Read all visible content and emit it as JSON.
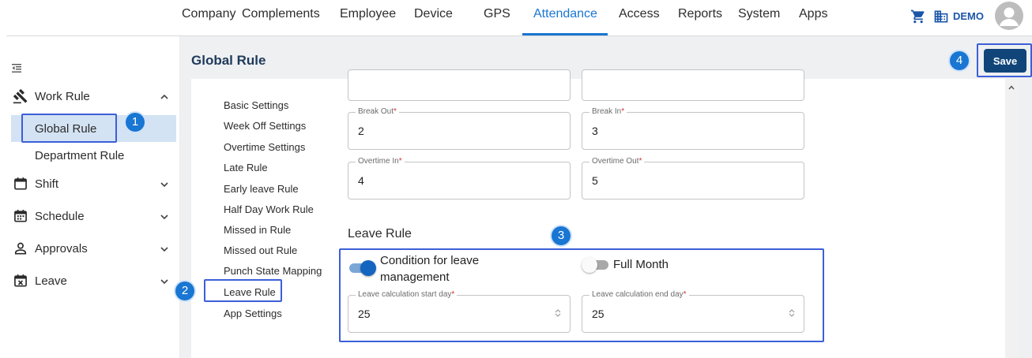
{
  "nav": {
    "items": [
      "Company",
      "Complements",
      "Employee",
      "Device",
      "GPS",
      "Attendance",
      "Access",
      "Reports",
      "System",
      "Apps"
    ],
    "active": "Attendance",
    "user": "DEMO",
    "accent_color": "#1976d2",
    "icons": [
      "cart-icon",
      "building-icon",
      "user-avatar-icon"
    ]
  },
  "sidebar": {
    "work_rule": "Work Rule",
    "global_rule": "Global Rule",
    "department_rule": "Department Rule",
    "shift": "Shift",
    "schedule": "Schedule",
    "approvals": "Approvals",
    "leave": "Leave"
  },
  "header": {
    "title": "Global Rule",
    "save_label": "Save",
    "save_color": "#11457a"
  },
  "tabs": [
    "Basic Settings",
    "Week Off Settings",
    "Overtime Settings",
    "Late Rule",
    "Early leave Rule",
    "Half Day Work Rule",
    "Missed in Rule",
    "Missed out Rule",
    "Punch State Mapping",
    "Leave Rule",
    "App Settings"
  ],
  "form": {
    "break_out": {
      "label": "Break Out",
      "value": "2"
    },
    "break_in": {
      "label": "Break In",
      "value": "3"
    },
    "overtime_in": {
      "label": "Overtime In",
      "value": "4"
    },
    "overtime_out": {
      "label": "Overtime Out",
      "value": "5"
    },
    "required_mark": "*",
    "leave_rule": {
      "title": "Leave Rule",
      "condition_label_line1": "Condition for leave",
      "condition_label_line2": "management",
      "condition_on": true,
      "full_month_label": "Full Month",
      "full_month_on": false,
      "start_day": {
        "label": "Leave calculation start day",
        "value": "25"
      },
      "end_day": {
        "label": "Leave calculation end day",
        "value": "25"
      }
    }
  },
  "annotations": {
    "badge_1": "1",
    "badge_2": "2",
    "badge_3": "3",
    "badge_4": "4",
    "highlight_color": "#3c5fd8"
  }
}
